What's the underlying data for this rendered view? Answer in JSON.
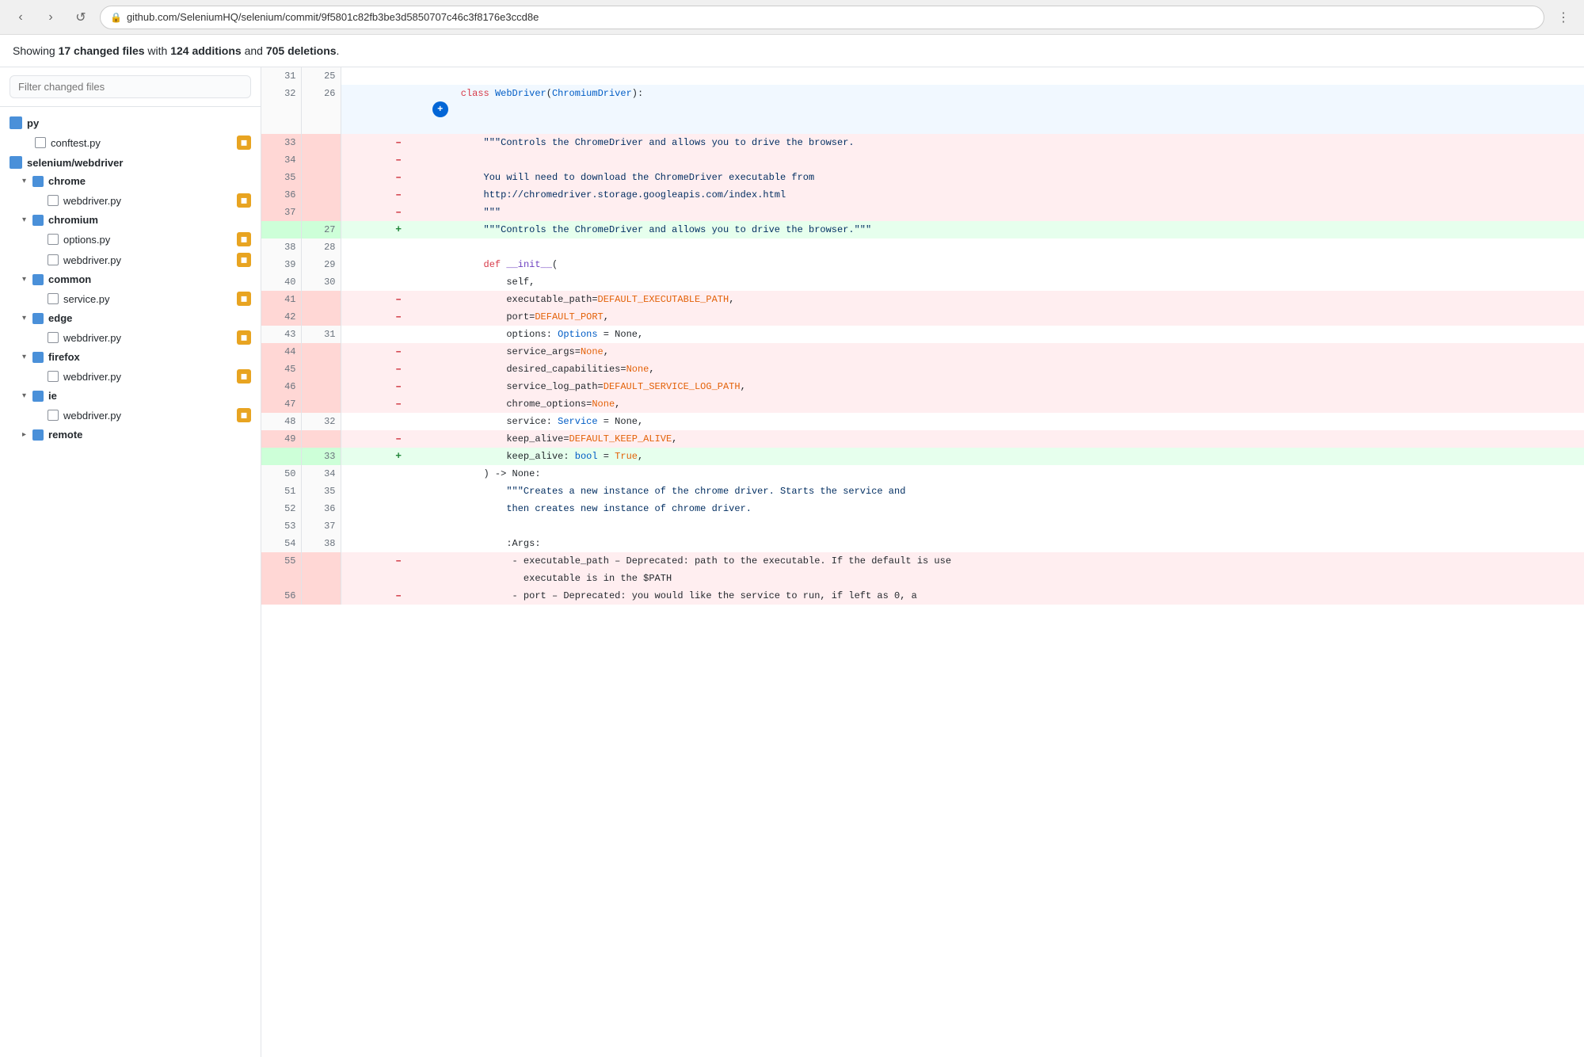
{
  "browser": {
    "url": "github.com/SeleniumHQ/selenium/commit/9f5801c82fb3be3d5850707c46c3f8176e3ccd8e",
    "back_label": "‹",
    "forward_label": "›",
    "reload_label": "↺"
  },
  "stats": {
    "text_prefix": "Showing ",
    "changed_files_count": "17 changed files",
    "text_middle": " with ",
    "additions_count": "124 additions",
    "text_and": " and ",
    "deletions_count": "705 deletions",
    "text_suffix": "."
  },
  "sidebar": {
    "filter_placeholder": "Filter changed files",
    "tree": [
      {
        "type": "folder",
        "label": "py",
        "level": 0
      },
      {
        "type": "file",
        "label": "conftest.py",
        "level": 1,
        "badge": true
      },
      {
        "type": "folder",
        "label": "selenium/webdriver",
        "level": 0
      },
      {
        "type": "folder",
        "label": "chrome",
        "level": 1,
        "expanded": true
      },
      {
        "type": "file",
        "label": "webdriver.py",
        "level": 2,
        "badge": true
      },
      {
        "type": "folder",
        "label": "chromium",
        "level": 1,
        "expanded": true
      },
      {
        "type": "file",
        "label": "options.py",
        "level": 2,
        "badge": true
      },
      {
        "type": "file",
        "label": "webdriver.py",
        "level": 2,
        "badge": true
      },
      {
        "type": "folder",
        "label": "common",
        "level": 1,
        "expanded": true
      },
      {
        "type": "file",
        "label": "service.py",
        "level": 2,
        "badge": true
      },
      {
        "type": "folder",
        "label": "edge",
        "level": 1,
        "expanded": true
      },
      {
        "type": "file",
        "label": "webdriver.py",
        "level": 2,
        "badge": true
      },
      {
        "type": "folder",
        "label": "firefox",
        "level": 1,
        "expanded": true
      },
      {
        "type": "file",
        "label": "webdriver.py",
        "level": 2,
        "badge": true
      },
      {
        "type": "folder",
        "label": "ie",
        "level": 1,
        "expanded": true
      },
      {
        "type": "file",
        "label": "webdriver.py",
        "level": 2,
        "badge": true
      },
      {
        "type": "folder",
        "label": "remote",
        "level": 1,
        "expanded": false
      }
    ]
  },
  "diff": {
    "lines": [
      {
        "old": "31",
        "new": "25",
        "type": "normal",
        "sign": "",
        "code": ""
      },
      {
        "old": "32",
        "new": "26",
        "type": "hunk",
        "sign": "+",
        "code": "class WebDriver(ChromiumDriver):"
      },
      {
        "old": "33",
        "new": "",
        "type": "del",
        "sign": "-",
        "code": "    \"\"\"Controls the ChromeDriver and allows you to drive the browser."
      },
      {
        "old": "34",
        "new": "",
        "type": "del",
        "sign": "-",
        "code": ""
      },
      {
        "old": "35",
        "new": "",
        "type": "del",
        "sign": "-",
        "code": "    You will need to download the ChromeDriver executable from"
      },
      {
        "old": "36",
        "new": "",
        "type": "del",
        "sign": "-",
        "code": "    http://chromedriver.storage.googleapis.com/index.html"
      },
      {
        "old": "37",
        "new": "",
        "type": "del",
        "sign": "-",
        "code": "    \"\"\""
      },
      {
        "old": "",
        "new": "27",
        "type": "add",
        "sign": "+",
        "code": "    \"\"\"Controls the ChromeDriver and allows you to drive the browser.\"\"\""
      },
      {
        "old": "38",
        "new": "28",
        "type": "normal",
        "sign": "",
        "code": ""
      },
      {
        "old": "39",
        "new": "29",
        "type": "normal",
        "sign": "",
        "code": "    def __init__("
      },
      {
        "old": "40",
        "new": "30",
        "type": "normal",
        "sign": "",
        "code": "        self,"
      },
      {
        "old": "41",
        "new": "",
        "type": "del",
        "sign": "-",
        "code": "        executable_path=DEFAULT_EXECUTABLE_PATH,"
      },
      {
        "old": "42",
        "new": "",
        "type": "del",
        "sign": "-",
        "code": "        port=DEFAULT_PORT,"
      },
      {
        "old": "43",
        "new": "31",
        "type": "normal",
        "sign": "",
        "code": "        options: Options = None,"
      },
      {
        "old": "44",
        "new": "",
        "type": "del",
        "sign": "-",
        "code": "        service_args=None,"
      },
      {
        "old": "45",
        "new": "",
        "type": "del",
        "sign": "-",
        "code": "        desired_capabilities=None,"
      },
      {
        "old": "46",
        "new": "",
        "type": "del",
        "sign": "-",
        "code": "        service_log_path=DEFAULT_SERVICE_LOG_PATH,"
      },
      {
        "old": "47",
        "new": "",
        "type": "del",
        "sign": "-",
        "code": "        chrome_options=None,"
      },
      {
        "old": "48",
        "new": "32",
        "type": "normal",
        "sign": "",
        "code": "        service: Service = None,"
      },
      {
        "old": "49",
        "new": "",
        "type": "del",
        "sign": "-",
        "code": "        keep_alive=DEFAULT_KEEP_ALIVE,"
      },
      {
        "old": "",
        "new": "33",
        "type": "add",
        "sign": "+",
        "code": "        keep_alive: bool = True,"
      },
      {
        "old": "50",
        "new": "34",
        "type": "normal",
        "sign": "",
        "code": "    ) -> None:"
      },
      {
        "old": "51",
        "new": "35",
        "type": "normal",
        "sign": "",
        "code": "        \"\"\"Creates a new instance of the chrome driver. Starts the service and"
      },
      {
        "old": "52",
        "new": "36",
        "type": "normal",
        "sign": "",
        "code": "        then creates new instance of chrome driver."
      },
      {
        "old": "53",
        "new": "37",
        "type": "normal",
        "sign": "",
        "code": ""
      },
      {
        "old": "54",
        "new": "38",
        "type": "normal",
        "sign": "",
        "code": "        :Args:"
      },
      {
        "old": "55",
        "new": "",
        "type": "del",
        "sign": "-",
        "code": "         - executable_path - Deprecated: path to the executable. If the default is use"
      },
      {
        "old": "",
        "new": "",
        "type": "del-continuation",
        "sign": "",
        "code": "           executable is in the $PATH"
      },
      {
        "old": "56",
        "new": "",
        "type": "del",
        "sign": "-",
        "code": "         - port - Deprecated: you would like the service to run, if left as 0, a"
      }
    ]
  },
  "colors": {
    "del_bg": "#ffeef0",
    "add_bg": "#e6ffed",
    "hunk_bg": "#f1f8ff",
    "normal_bg": "#ffffff",
    "badge_color": "#e8a421",
    "folder_color": "#4a90d9"
  }
}
